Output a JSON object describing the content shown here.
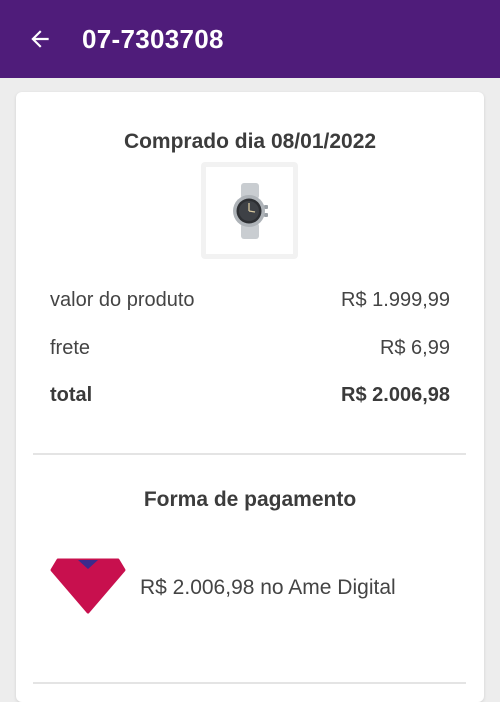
{
  "header": {
    "title": "07-7303708",
    "back_icon": "arrow-left-icon",
    "background": "#4f1c7a"
  },
  "order": {
    "purchase_date_label": "Comprado dia 08/01/2022",
    "product_image_icon": "smartwatch-icon",
    "rows": [
      {
        "label": "valor do produto",
        "value": "R$ 1.999,99"
      },
      {
        "label": "frete",
        "value": "R$ 6,99"
      },
      {
        "label": "total",
        "value": "R$ 2.006,98"
      }
    ]
  },
  "payment": {
    "heading": "Forma de pagamento",
    "method_icon": "ame-digital-icon",
    "method_text": "R$ 2.006,98 no Ame Digital",
    "method_color": "#c8104e"
  }
}
